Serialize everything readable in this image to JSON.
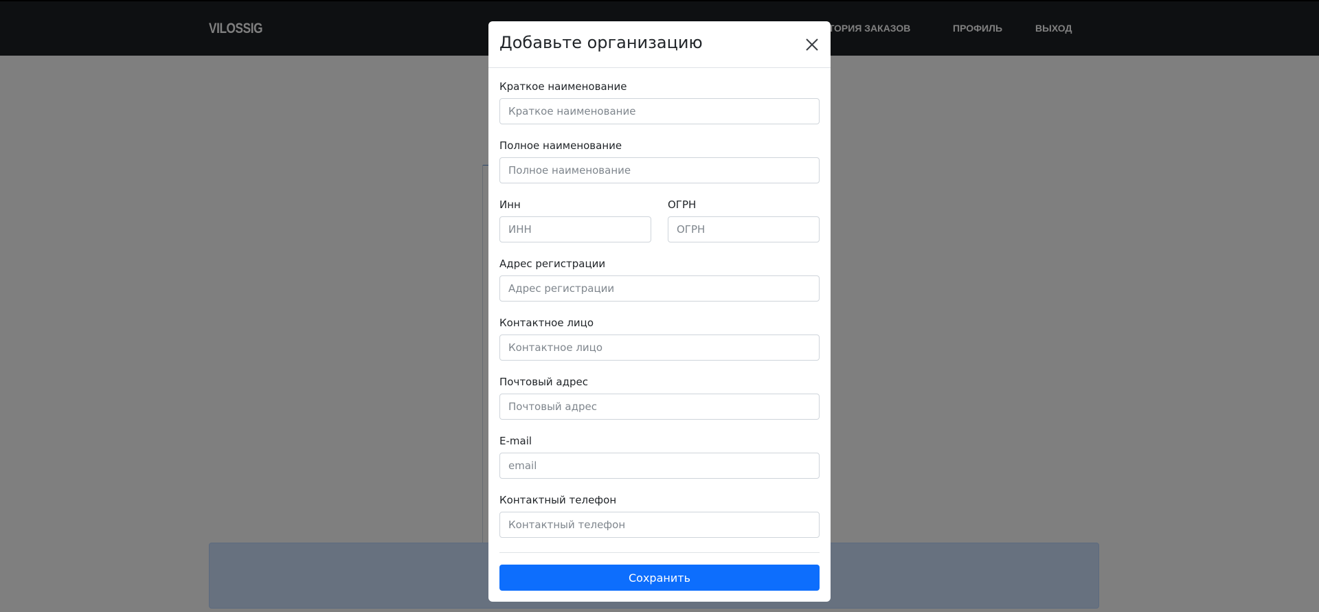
{
  "header": {
    "logo_text": "VILOSSIG",
    "nav": {
      "orders": "ИСТОРИЯ ЗАКАЗОВ",
      "profile": "ПРОФИЛЬ",
      "exit": "ВЫХОД"
    }
  },
  "modal": {
    "title": "Добавьте организацию",
    "fields": {
      "short_name": {
        "label": "Краткое наименование",
        "placeholder": "Краткое наименование",
        "value": ""
      },
      "full_name": {
        "label": "Полное наименование",
        "placeholder": "Полное наименование",
        "value": ""
      },
      "inn": {
        "label": "Инн",
        "placeholder": "ИНН",
        "value": ""
      },
      "ogrn": {
        "label": "ОГРН",
        "placeholder": "ОГРН",
        "value": ""
      },
      "reg_address": {
        "label": "Адрес регистрации",
        "placeholder": "Адрес регистрации",
        "value": ""
      },
      "contact_person": {
        "label": "Контактное лицо",
        "placeholder": "Контактное лицо",
        "value": ""
      },
      "postal_address": {
        "label": "Почтовый адрес",
        "placeholder": "Почтовый адрес",
        "value": ""
      },
      "email": {
        "label": "E-mail",
        "placeholder": "email",
        "value": ""
      },
      "phone": {
        "label": "Контактный телефон",
        "placeholder": "Контактный телефон",
        "value": ""
      }
    },
    "save_label": "Сохранить",
    "close_icon": "close-icon"
  },
  "colors": {
    "primary": "#0d6efd",
    "header_bg": "#1d2024",
    "alert_bg": "#cfe2ff"
  }
}
